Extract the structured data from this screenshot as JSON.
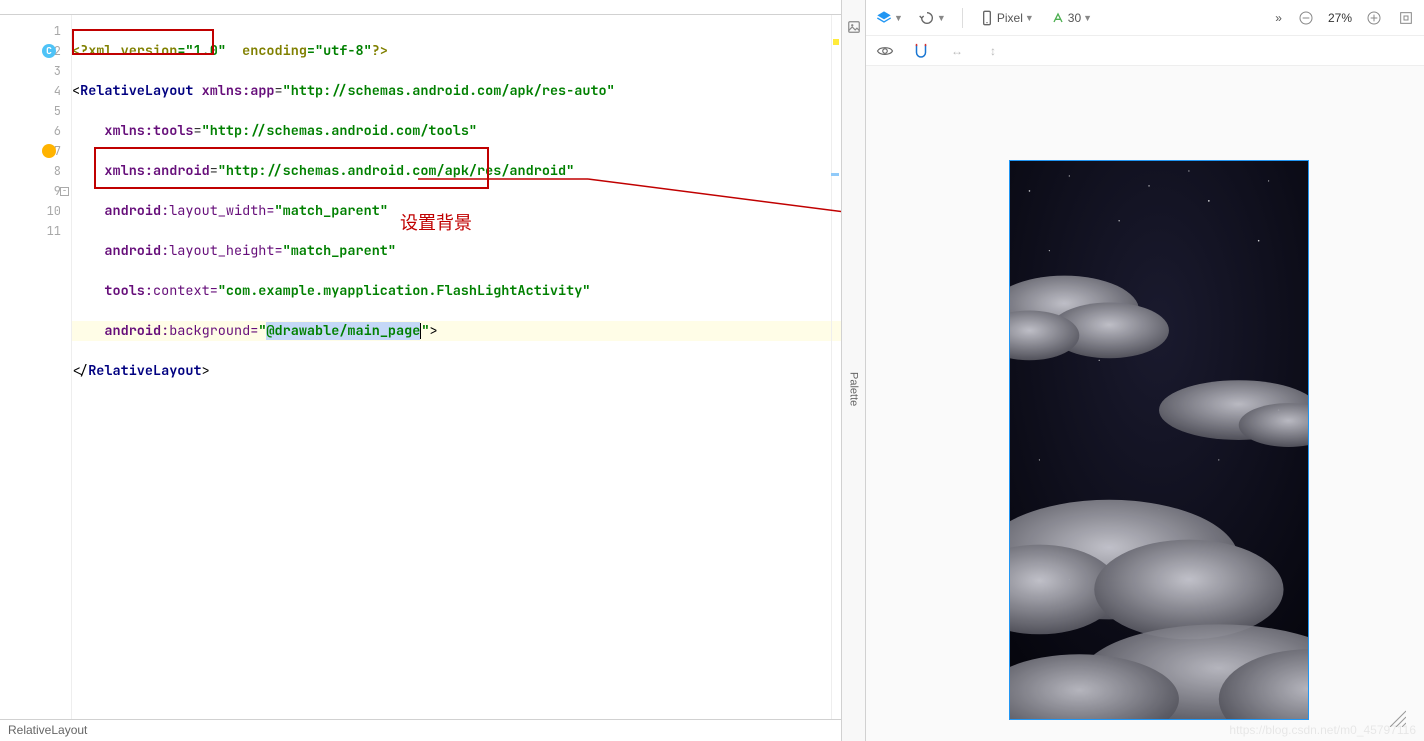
{
  "tabs": [
    {
      "label": ""
    },
    {
      "label": ""
    },
    {
      "label": ""
    }
  ],
  "gutter_icon_c": "C",
  "code": {
    "l1": {
      "a": "<?",
      "b": "xml version",
      "c": "=",
      "d": "\"1.0\"",
      "e": "  encoding",
      "f": "=",
      "g": "\"utf-8\"",
      "h": "?>"
    },
    "l2": {
      "a": "<",
      "b": "RelativeLayout ",
      "c": "xmlns:",
      "d": "app",
      "e": "=",
      "f": "\"http://schemas.android.com/apk/res-auto\""
    },
    "l3": {
      "a": "    ",
      "b": "xmlns:",
      "c": "tools",
      "d": "=",
      "e": "\"http://schemas.android.com/tools\""
    },
    "l4": {
      "a": "    ",
      "b": "xmlns:",
      "c": "android",
      "d": "=",
      "e": "\"http://schemas.android.com/apk/res/android\""
    },
    "l5": {
      "a": "    ",
      "b": "android",
      "c": ":layout_width=",
      "d": "\"match_parent\""
    },
    "l6": {
      "a": "    ",
      "b": "android",
      "c": ":layout_height=",
      "d": "\"match_parent\""
    },
    "l7": {
      "a": "    ",
      "b": "tools",
      "c": ":context=",
      "d": "\"com.example.myapplication.FlashLightActivity\""
    },
    "l8": {
      "a": "    ",
      "b": "android",
      "c": ":background=",
      "d": "\"",
      "e": "@drawable/main_page",
      "f": "\"",
      "g": ">"
    },
    "l9": {
      "a": "</",
      "b": "RelativeLayout",
      "c": ">"
    }
  },
  "line_numbers": [
    "1",
    "2",
    "3",
    "4",
    "5",
    "6",
    "7",
    "8",
    "9",
    "10",
    "11"
  ],
  "annotation": "设置背景",
  "breadcrumb": "RelativeLayout",
  "preview": {
    "palette_label": "Palette",
    "device": "Pixel",
    "api": "30",
    "zoom": "27%"
  },
  "watermark": "https://blog.csdn.net/m0_45797116"
}
